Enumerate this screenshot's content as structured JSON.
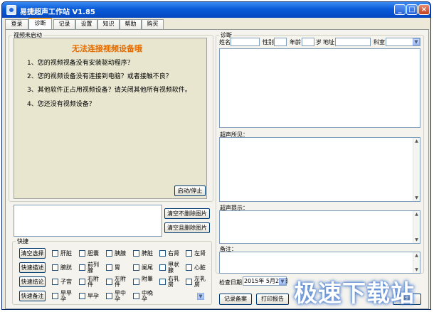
{
  "window": {
    "title": "易捷超声工作站 V1.85"
  },
  "tabs": [
    {
      "label": "登录"
    },
    {
      "label": "诊断"
    },
    {
      "label": "记录"
    },
    {
      "label": "设置"
    },
    {
      "label": "知识"
    },
    {
      "label": "帮助"
    },
    {
      "label": "购买"
    }
  ],
  "video": {
    "group_label": "视频未启动",
    "headline": "无法连接视频设备哦",
    "reasons": [
      "1、您的视频视备没有安装驱动程序？",
      "2、您的视频设备没有连接到电脑？或者接触不良？",
      "3、其他软件正占用视频设备？请关闭其他所有视频软件。",
      "4、您还没有视频设备？"
    ],
    "start_stop_button": "启动/停止"
  },
  "images": {
    "clear_keep_button": "清空不删除图片",
    "clear_delete_button": "清空且删除图片"
  },
  "quick": {
    "group_label": "快捷",
    "buttons": [
      "清空选择",
      "快速描述",
      "快速结论",
      "快速备注"
    ],
    "rows": [
      [
        "肝脏",
        "胆囊",
        "胰腺",
        "脾脏",
        "右肾",
        "左肾"
      ],
      [
        "膀胱",
        "前列腺",
        "胃",
        "阑尾",
        "甲状腺",
        "心脏"
      ],
      [
        "子宫",
        "右附件",
        "左附件",
        "附睾",
        "右乳房",
        "左乳房"
      ],
      [
        "早早孕",
        "早孕",
        "早中孕",
        "中晚孕"
      ]
    ]
  },
  "diagnosis": {
    "group_label": "诊断",
    "fields": {
      "name": "姓名",
      "gender": "性别",
      "age": "年龄",
      "age_unit": "岁",
      "address": "地址",
      "department": "科室"
    },
    "findings_label": "超声所见：",
    "hints_label": "超声提示：",
    "notes_label": "备注：",
    "exam_date_label": "检查日期",
    "exam_date": "2015年 5月24日"
  },
  "actions": {
    "save_record": "记录备案",
    "print_report": "打印报告",
    "new": "新建"
  },
  "watermark": "极速下载站"
}
